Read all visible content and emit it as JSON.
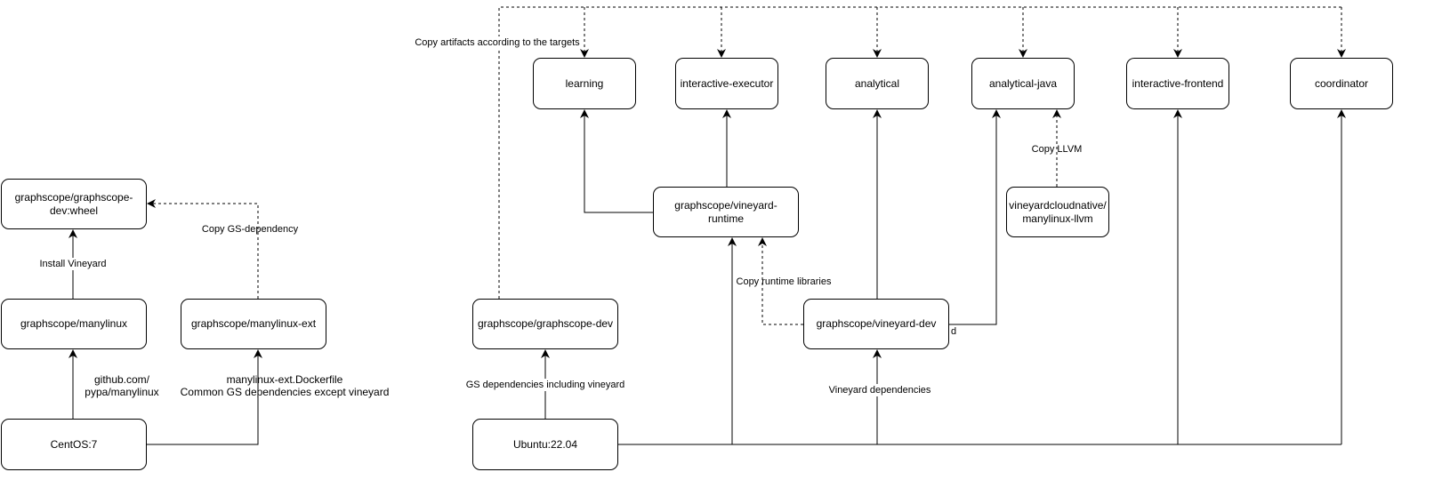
{
  "nodes": {
    "wheel": "graphscope/graphscope-dev:wheel",
    "manylinux": "graphscope/manylinux",
    "manylinux_ext": "graphscope/manylinux-ext",
    "centos": "CentOS:7",
    "graphscope_dev": "graphscope/graphscope-dev",
    "ubuntu": "Ubuntu:22.04",
    "learning": "learning",
    "interactive_executor": "interactive-executor",
    "analytical": "analytical",
    "analytical_java": "analytical-java",
    "interactive_frontend": "interactive-frontend",
    "coordinator": "coordinator",
    "vineyard_runtime": "graphscope/vineyard-runtime",
    "vineyard_llvm": "vineyardcloudnative/manylinux-llvm",
    "vineyard_dev": "graphscope/vineyard-dev"
  },
  "edges": {
    "install_vineyard": "Install Vineyard",
    "copy_gs_dependency": "Copy GS-dependency",
    "manylinux_src_1": "github.com/",
    "manylinux_src_2": "pypa/manylinux",
    "ext_1": "manylinux-ext.Dockerfile",
    "ext_2": "Common GS dependencies except vineyard",
    "gs_deps": "GS dependencies including vineyard",
    "copy_artifacts": "Copy artifacts according to the targets",
    "vineyard_deps": "Vineyard dependencies",
    "copy_runtime": "Copy runtime libraries",
    "copy_llvm": "Copy LLVM",
    "stray_d": "d"
  },
  "colors": {
    "stroke": "#000000",
    "background": "#ffffff"
  }
}
